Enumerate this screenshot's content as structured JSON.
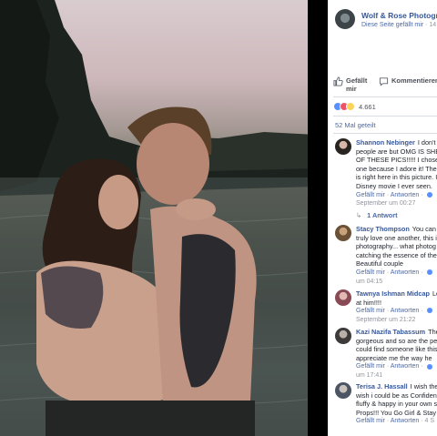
{
  "post": {
    "page_name": "Wolf & Rose Photogra",
    "page_sub": "Diese Seite gefällt mir",
    "page_time": "· 14"
  },
  "actions": {
    "like_label": "Gefällt mir",
    "comment_label": "Kommentieren"
  },
  "reactions": {
    "count": "4.661"
  },
  "shares": {
    "label": "52 Mal geteilt"
  },
  "comments": [
    {
      "lines": [
        "I don't k",
        "people are but OMG IS SHE",
        "OF THESE PICS!!!!! I chose t",
        "one because I adore it! The",
        "is right here in this picture. I",
        "Disney movie I ever seen."
      ],
      "author": "Shannon Nebinger",
      "like": "Gefällt mir",
      "reply": "Antworten",
      "time": "September um 00:27",
      "replies_link": "1 Antwort"
    },
    {
      "lines": [
        "You can t",
        "truly love one another, this i",
        "photography... what photog",
        "catching the essence of the",
        "Beautiful couple"
      ],
      "author": "Stacy Thompson",
      "like": "Gefällt mir",
      "reply": "Antworten",
      "time": "um 04:15"
    },
    {
      "lines": [
        "Lo",
        "at him!!!!"
      ],
      "author": "Tawnya Ishman Midcap",
      "like": "Gefällt mir",
      "reply": "Antworten",
      "time": "September um 21:22"
    },
    {
      "lines": [
        "The",
        "gorgeous and so are the pe",
        "could find someone like this",
        "appreciate me the way he"
      ],
      "author": "Kazi Nazifa Tabassum",
      "like": "Gefällt mir",
      "reply": "Antworten",
      "time": "um 17:41"
    },
    {
      "lines": [
        "I wish the",
        "wish i could be as Confiden",
        "fluffy & happy in your own s",
        "Props!!! You Go Girl & Stay"
      ],
      "author": "Terisa J. Hassall",
      "like": "Gefällt mir",
      "reply": "Antworten",
      "time": "4 S"
    }
  ],
  "colors": {
    "link_blue": "#365899",
    "meta_gray": "#90949c",
    "reaction_like": "#5890ff",
    "reaction_love": "#f25268",
    "reaction_wow": "#fcd35b"
  }
}
